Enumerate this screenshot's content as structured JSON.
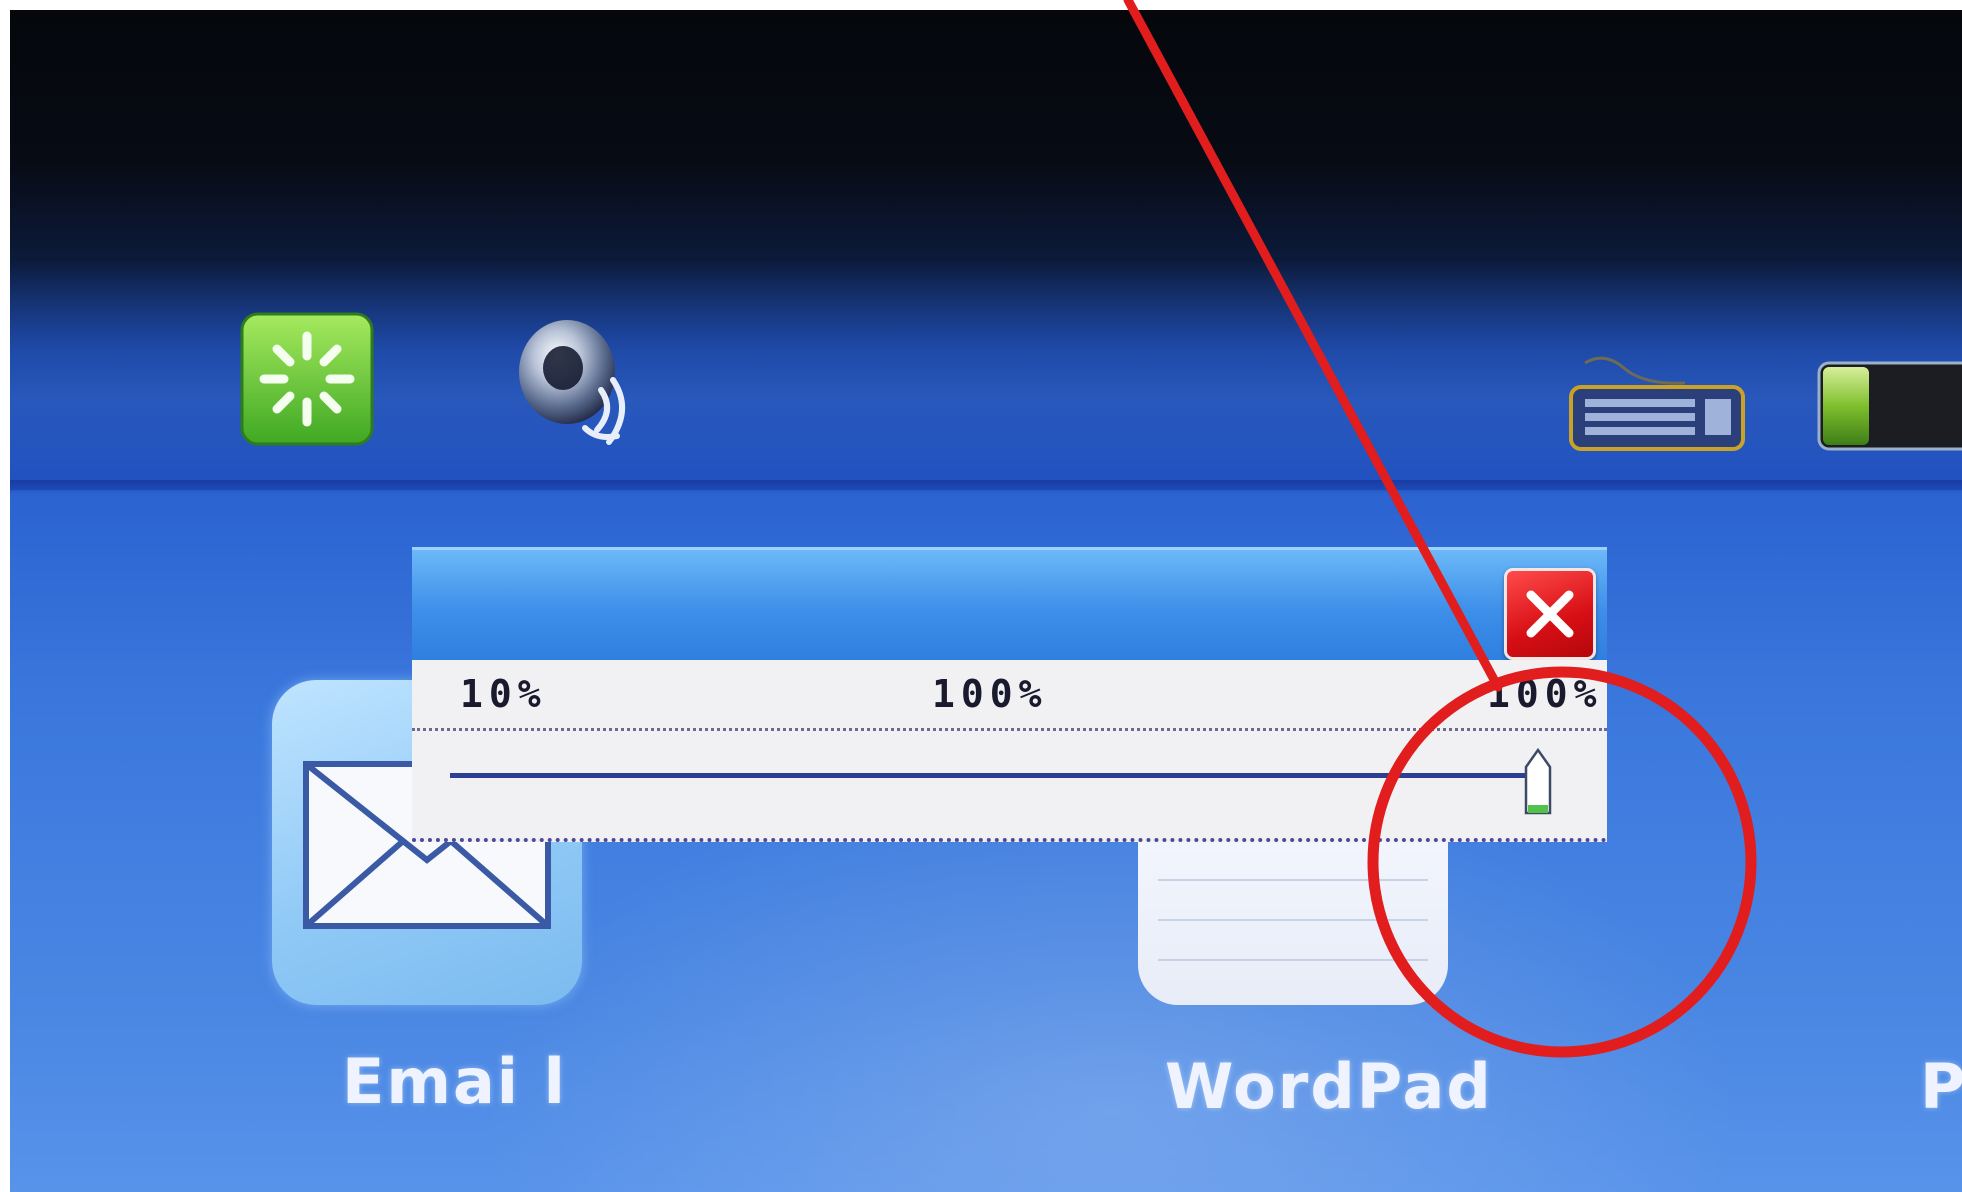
{
  "desktop": {
    "status_icons": [
      "refresh-icon",
      "speaker-icon",
      "keyboard-icon",
      "battery-icon"
    ],
    "apps": [
      {
        "label": "Emai l",
        "icon": "email-icon"
      },
      {
        "label": "WordPad",
        "icon": "wordpad-icon"
      },
      {
        "label": "P",
        "icon": "unknown"
      }
    ]
  },
  "brightness_dialog": {
    "scale": {
      "min_label": "10%",
      "mid_label": "100%",
      "current_label": "100%"
    },
    "slider": {
      "min": 10,
      "max": 100,
      "value": 100
    },
    "close_icon": "close-icon"
  },
  "colors": {
    "desktop_blue": "#3b78dd",
    "close_button_red": "#d60f15",
    "annotation_red": "#e11d1d",
    "thumb_green": "#52c24a"
  }
}
